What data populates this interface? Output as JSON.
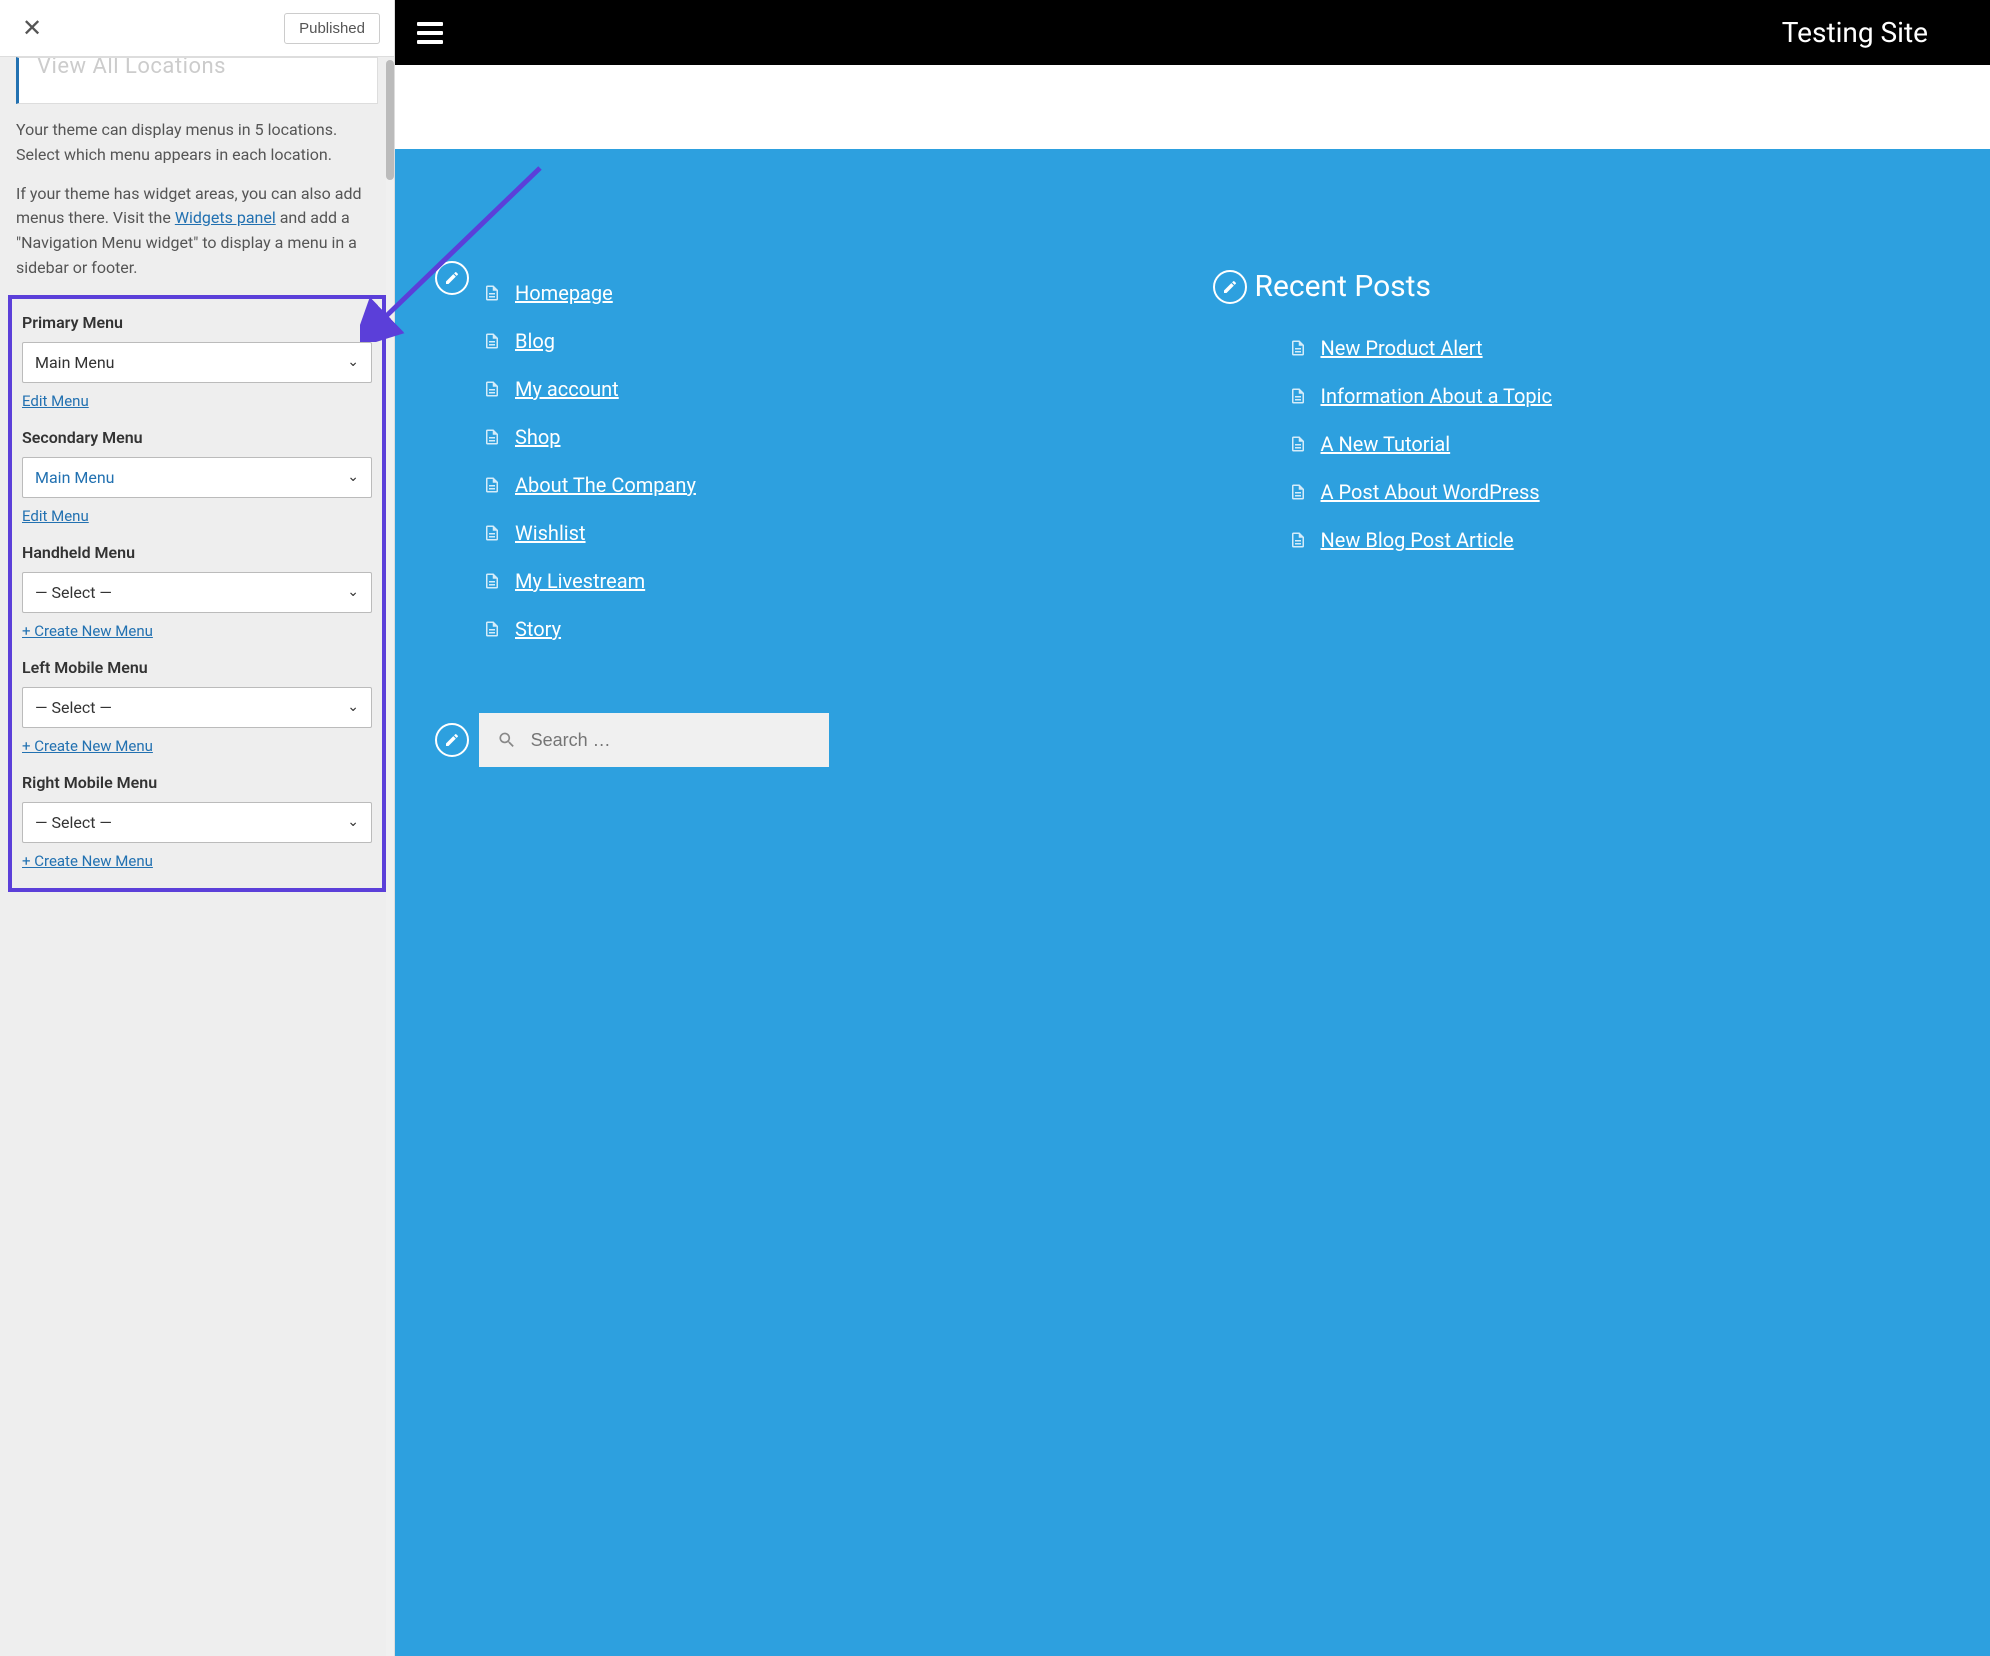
{
  "customizer": {
    "published_label": "Published",
    "truncated_heading": "View All Locations",
    "intro1": "Your theme can display menus in 5 locations. Select which menu appears in each location.",
    "intro2_prefix": "If your theme has widget areas, you can also add menus there. Visit the ",
    "intro2_link": "Widgets panel",
    "intro2_suffix": " and add a \"Navigation Menu widget\" to display a menu in a sidebar or footer.",
    "menus": [
      {
        "label": "Primary Menu",
        "value": "Main Menu",
        "value_style": "black",
        "action": "Edit Menu"
      },
      {
        "label": "Secondary Menu",
        "value": "Main Menu",
        "value_style": "blue",
        "action": "Edit Menu"
      },
      {
        "label": "Handheld Menu",
        "value": "— Select —",
        "value_style": "black",
        "action": "+ Create New Menu"
      },
      {
        "label": "Left Mobile Menu",
        "value": "— Select —",
        "value_style": "black",
        "action": "+ Create New Menu"
      },
      {
        "label": "Right Mobile Menu",
        "value": "— Select —",
        "value_style": "black",
        "action": "+ Create New Menu"
      }
    ]
  },
  "preview": {
    "site_title": "Testing Site",
    "nav_links": [
      "Homepage",
      "Blog",
      "My account",
      "Shop",
      "About The Company",
      "Wishlist",
      "My Livestream",
      "Story"
    ],
    "recent_posts_title": "Recent Posts",
    "recent_posts": [
      "New Product Alert",
      "Information About a Topic",
      "A New Tutorial",
      "A Post About WordPress",
      "New Blog Post Article"
    ],
    "search_placeholder": "Search …"
  }
}
